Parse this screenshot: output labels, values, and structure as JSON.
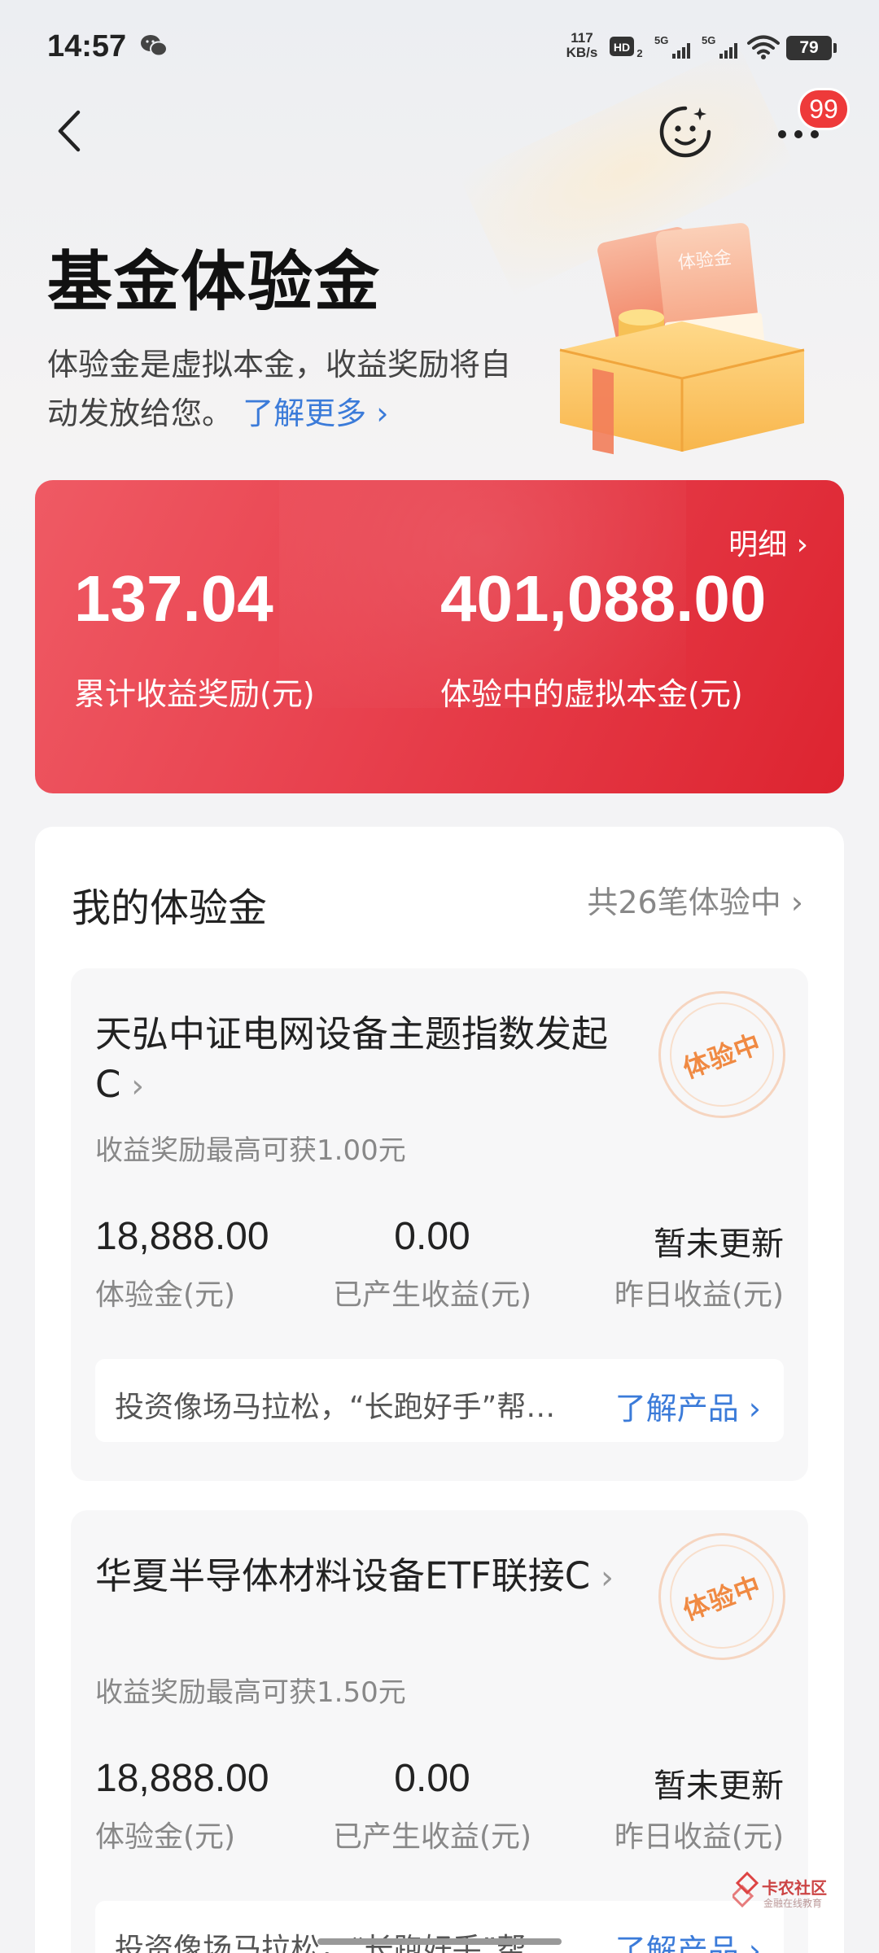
{
  "status_bar": {
    "time": "14:57",
    "net_speed_value": "117",
    "net_speed_unit": "KB/s",
    "battery": "79",
    "icons": [
      "wechat-icon",
      "hd-icon",
      "signal-5g-icon",
      "signal-5g-icon",
      "wifi-icon",
      "battery-icon"
    ]
  },
  "nav": {
    "back_icon": "chevron-left-icon",
    "smiley_icon": "smiley-service-icon",
    "more_icon": "more-dots-icon",
    "badge_count": "99"
  },
  "header": {
    "title": "基金体验金",
    "intro": "体验金是虚拟本金，收益奖励将自动发放给您。",
    "learn_more": "了解更多 ›"
  },
  "summary": {
    "detail_link": "明细 ›",
    "reward_value": "137.04",
    "reward_label": "累计收益奖励(元)",
    "principal_value": "401,088.00",
    "principal_label": "体验中的虚拟本金(元)"
  },
  "my_funds": {
    "title": "我的体验金",
    "count_text": "共26笔体验中 ›",
    "items": [
      {
        "name": "天弘中证电网设备主题指数发起C",
        "subtitle": "收益奖励最高可获1.00元",
        "stamp": "体验中",
        "amount": "18,888.00",
        "amount_label": "体验金(元)",
        "earned": "0.00",
        "earned_label": "已产生收益(元)",
        "yesterday": "暂未更新",
        "yesterday_label": "昨日收益(元)",
        "note": "投资像场马拉松，“长跑好手”帮…",
        "note_link": "了解产品 ›"
      },
      {
        "name": "华夏半导体材料设备ETF联接C",
        "subtitle": "收益奖励最高可获1.50元",
        "stamp": "体验中",
        "amount": "18,888.00",
        "amount_label": "体验金(元)",
        "earned": "0.00",
        "earned_label": "已产生收益(元)",
        "yesterday": "暂未更新",
        "yesterday_label": "昨日收益(元)",
        "note": "投资像场马拉松，“长跑好手”帮…",
        "note_link": "了解产品 ›"
      }
    ]
  },
  "watermark": {
    "line1": "卡农社区",
    "line2": "金融在线教育"
  }
}
